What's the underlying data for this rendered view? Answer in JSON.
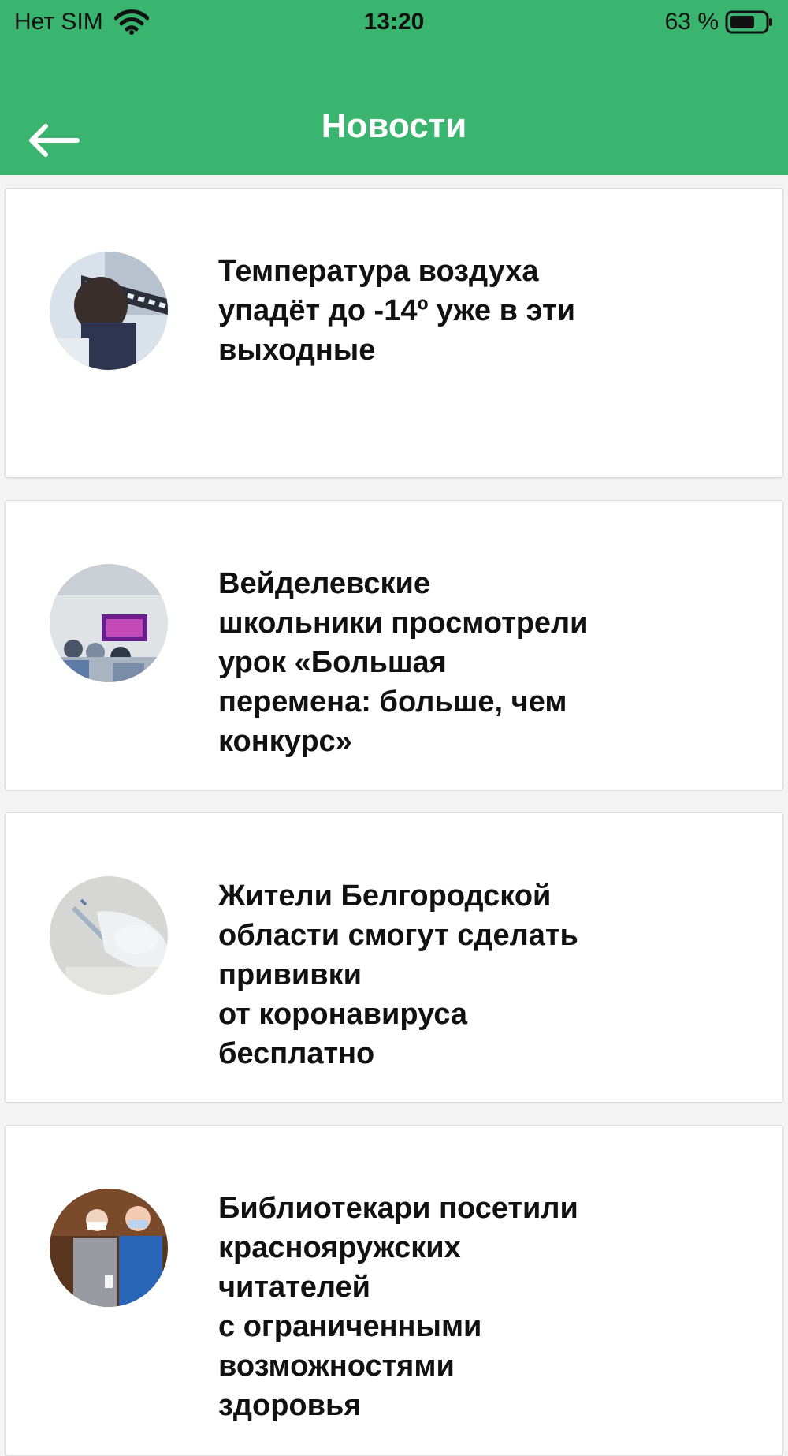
{
  "status_bar": {
    "carrier": "Нет SIM",
    "time": "13:20",
    "battery": "63 %"
  },
  "header": {
    "title": "Новости",
    "back_icon": "arrow-left-icon"
  },
  "colors": {
    "accent": "#3ab56f",
    "card": "#ffffff",
    "background": "#f3f3f3",
    "text": "#111111"
  },
  "news": [
    {
      "title": "Температура воздуха\nупадёт до -14º уже в эти\nвыходные",
      "image": "winter-scene"
    },
    {
      "title": "Вейделевские\nшкольники просмотрели\nурок «Большая\nперемена: больше, чем\nконкурс»",
      "image": "classroom-screen"
    },
    {
      "title": "Жители Белгородской\nобласти смогут сделать\nпрививки\nот коронавируса\nбесплатно",
      "image": "vaccine-syringe"
    },
    {
      "title": "Библиотекари посетили\nкраснояружских\nчитателей\nс ограниченными\nвозможностями\nздоровья",
      "image": "two-women-masks"
    }
  ]
}
